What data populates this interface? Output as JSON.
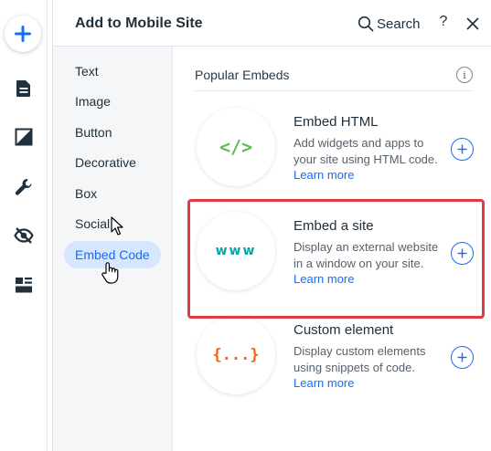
{
  "rail": {
    "items": [
      {
        "icon": "plus-icon"
      },
      {
        "icon": "page-icon"
      },
      {
        "icon": "background-icon"
      },
      {
        "icon": "wrench-icon"
      },
      {
        "icon": "hidden-eye-icon"
      },
      {
        "icon": "layout-blocks-icon"
      }
    ]
  },
  "panel": {
    "title": "Add to Mobile Site",
    "search_label": "Search",
    "help_label": "?",
    "close_icon": "close-icon"
  },
  "categories": [
    {
      "label": "Text",
      "selected": false
    },
    {
      "label": "Image",
      "selected": false
    },
    {
      "label": "Button",
      "selected": false
    },
    {
      "label": "Decorative",
      "selected": false
    },
    {
      "label": "Box",
      "selected": false
    },
    {
      "label": "Social",
      "selected": false
    },
    {
      "label": "Embed Code",
      "selected": true
    }
  ],
  "content": {
    "section_title": "Popular Embeds",
    "info_icon": "i",
    "items": [
      {
        "title": "Embed HTML",
        "description": "Add widgets and apps to your site using HTML code.",
        "link": "Learn more",
        "icon_text": "</>",
        "icon_color": "#60bc57"
      },
      {
        "title": "Embed a site",
        "description": "Display an external website in a window on your site.",
        "link": "Learn more",
        "icon_text": "www",
        "icon_color": "#00a9a5",
        "highlighted": true
      },
      {
        "title": "Custom element",
        "description": "Display custom elements using snippets of code.",
        "link": "Learn more",
        "icon_text": "{...}",
        "icon_color": "#fe620f"
      }
    ]
  },
  "colors": {
    "accent": "#116dff",
    "selected_bg": "#d6e6fe",
    "highlight": "#e03a43"
  }
}
